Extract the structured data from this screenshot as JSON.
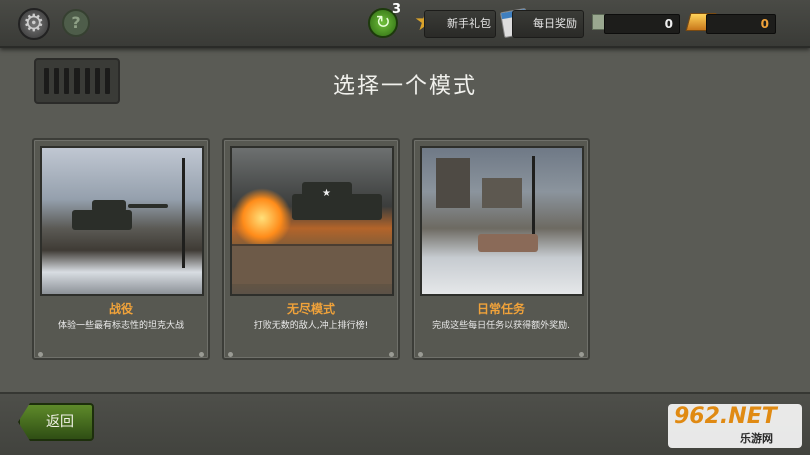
{
  "topbar": {
    "refresh_count": "3",
    "newbie_pack": "新手礼包",
    "daily_reward": "每日奖励",
    "cash": "0",
    "gold": "0"
  },
  "header": {
    "title": "选择一个模式"
  },
  "modes": [
    {
      "title": "战役",
      "desc": "体验一些最有标志性的坦克大战"
    },
    {
      "title": "无尽模式",
      "desc": "打败无数的敌人,冲上排行榜!"
    },
    {
      "title": "日常任务",
      "desc": "完成这些每日任务以获得额外奖励."
    }
  ],
  "footer": {
    "back_label": "返回"
  },
  "watermark": {
    "main": "962.NET",
    "sub": "乐游网"
  },
  "colors": {
    "accent_orange": "#f0a23a",
    "back_green": "#5e8a2a",
    "gold": "#ffd35a"
  }
}
